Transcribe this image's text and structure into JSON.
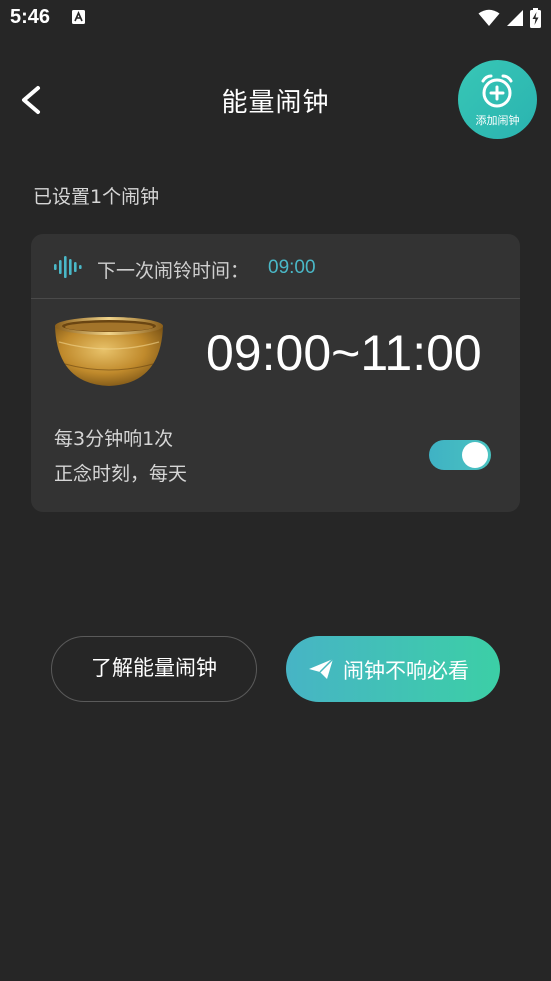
{
  "status_bar": {
    "time": "5:46"
  },
  "header": {
    "title": "能量闹钟",
    "add_alarm_label": "添加闹钟"
  },
  "alarm_count_text": "已设置1个闹钟",
  "alarm_card": {
    "next_label": "下一次闹铃时间：",
    "next_time": "09:00",
    "time_range": "09:00~11:00",
    "interval": "每3分钟响1次",
    "schedule": "正念时刻，每天",
    "enabled": true
  },
  "buttons": {
    "learn": "了解能量闹钟",
    "help": "闹钟不响必看"
  },
  "colors": {
    "accent": "#4ab8c7",
    "teal_green": "#3ccfa6",
    "background": "#262626",
    "card": "#333333"
  },
  "icons": {
    "back": "chevron-left-icon",
    "add_alarm": "alarm-plus-icon",
    "waveform": "waveform-icon",
    "send": "paper-plane-icon"
  }
}
